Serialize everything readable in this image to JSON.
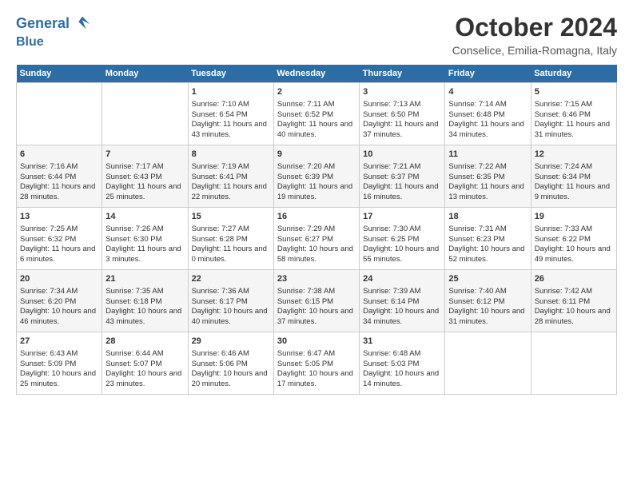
{
  "header": {
    "logo_line1": "General",
    "logo_line2": "Blue",
    "month": "October 2024",
    "location": "Conselice, Emilia-Romagna, Italy"
  },
  "days_of_week": [
    "Sunday",
    "Monday",
    "Tuesday",
    "Wednesday",
    "Thursday",
    "Friday",
    "Saturday"
  ],
  "weeks": [
    [
      {
        "day": "",
        "content": ""
      },
      {
        "day": "",
        "content": ""
      },
      {
        "day": "1",
        "content": "Sunrise: 7:10 AM\nSunset: 6:54 PM\nDaylight: 11 hours and 43 minutes."
      },
      {
        "day": "2",
        "content": "Sunrise: 7:11 AM\nSunset: 6:52 PM\nDaylight: 11 hours and 40 minutes."
      },
      {
        "day": "3",
        "content": "Sunrise: 7:13 AM\nSunset: 6:50 PM\nDaylight: 11 hours and 37 minutes."
      },
      {
        "day": "4",
        "content": "Sunrise: 7:14 AM\nSunset: 6:48 PM\nDaylight: 11 hours and 34 minutes."
      },
      {
        "day": "5",
        "content": "Sunrise: 7:15 AM\nSunset: 6:46 PM\nDaylight: 11 hours and 31 minutes."
      }
    ],
    [
      {
        "day": "6",
        "content": "Sunrise: 7:16 AM\nSunset: 6:44 PM\nDaylight: 11 hours and 28 minutes."
      },
      {
        "day": "7",
        "content": "Sunrise: 7:17 AM\nSunset: 6:43 PM\nDaylight: 11 hours and 25 minutes."
      },
      {
        "day": "8",
        "content": "Sunrise: 7:19 AM\nSunset: 6:41 PM\nDaylight: 11 hours and 22 minutes."
      },
      {
        "day": "9",
        "content": "Sunrise: 7:20 AM\nSunset: 6:39 PM\nDaylight: 11 hours and 19 minutes."
      },
      {
        "day": "10",
        "content": "Sunrise: 7:21 AM\nSunset: 6:37 PM\nDaylight: 11 hours and 16 minutes."
      },
      {
        "day": "11",
        "content": "Sunrise: 7:22 AM\nSunset: 6:35 PM\nDaylight: 11 hours and 13 minutes."
      },
      {
        "day": "12",
        "content": "Sunrise: 7:24 AM\nSunset: 6:34 PM\nDaylight: 11 hours and 9 minutes."
      }
    ],
    [
      {
        "day": "13",
        "content": "Sunrise: 7:25 AM\nSunset: 6:32 PM\nDaylight: 11 hours and 6 minutes."
      },
      {
        "day": "14",
        "content": "Sunrise: 7:26 AM\nSunset: 6:30 PM\nDaylight: 11 hours and 3 minutes."
      },
      {
        "day": "15",
        "content": "Sunrise: 7:27 AM\nSunset: 6:28 PM\nDaylight: 11 hours and 0 minutes."
      },
      {
        "day": "16",
        "content": "Sunrise: 7:29 AM\nSunset: 6:27 PM\nDaylight: 10 hours and 58 minutes."
      },
      {
        "day": "17",
        "content": "Sunrise: 7:30 AM\nSunset: 6:25 PM\nDaylight: 10 hours and 55 minutes."
      },
      {
        "day": "18",
        "content": "Sunrise: 7:31 AM\nSunset: 6:23 PM\nDaylight: 10 hours and 52 minutes."
      },
      {
        "day": "19",
        "content": "Sunrise: 7:33 AM\nSunset: 6:22 PM\nDaylight: 10 hours and 49 minutes."
      }
    ],
    [
      {
        "day": "20",
        "content": "Sunrise: 7:34 AM\nSunset: 6:20 PM\nDaylight: 10 hours and 46 minutes."
      },
      {
        "day": "21",
        "content": "Sunrise: 7:35 AM\nSunset: 6:18 PM\nDaylight: 10 hours and 43 minutes."
      },
      {
        "day": "22",
        "content": "Sunrise: 7:36 AM\nSunset: 6:17 PM\nDaylight: 10 hours and 40 minutes."
      },
      {
        "day": "23",
        "content": "Sunrise: 7:38 AM\nSunset: 6:15 PM\nDaylight: 10 hours and 37 minutes."
      },
      {
        "day": "24",
        "content": "Sunrise: 7:39 AM\nSunset: 6:14 PM\nDaylight: 10 hours and 34 minutes."
      },
      {
        "day": "25",
        "content": "Sunrise: 7:40 AM\nSunset: 6:12 PM\nDaylight: 10 hours and 31 minutes."
      },
      {
        "day": "26",
        "content": "Sunrise: 7:42 AM\nSunset: 6:11 PM\nDaylight: 10 hours and 28 minutes."
      }
    ],
    [
      {
        "day": "27",
        "content": "Sunrise: 6:43 AM\nSunset: 5:09 PM\nDaylight: 10 hours and 25 minutes."
      },
      {
        "day": "28",
        "content": "Sunrise: 6:44 AM\nSunset: 5:07 PM\nDaylight: 10 hours and 23 minutes."
      },
      {
        "day": "29",
        "content": "Sunrise: 6:46 AM\nSunset: 5:06 PM\nDaylight: 10 hours and 20 minutes."
      },
      {
        "day": "30",
        "content": "Sunrise: 6:47 AM\nSunset: 5:05 PM\nDaylight: 10 hours and 17 minutes."
      },
      {
        "day": "31",
        "content": "Sunrise: 6:48 AM\nSunset: 5:03 PM\nDaylight: 10 hours and 14 minutes."
      },
      {
        "day": "",
        "content": ""
      },
      {
        "day": "",
        "content": ""
      }
    ]
  ]
}
